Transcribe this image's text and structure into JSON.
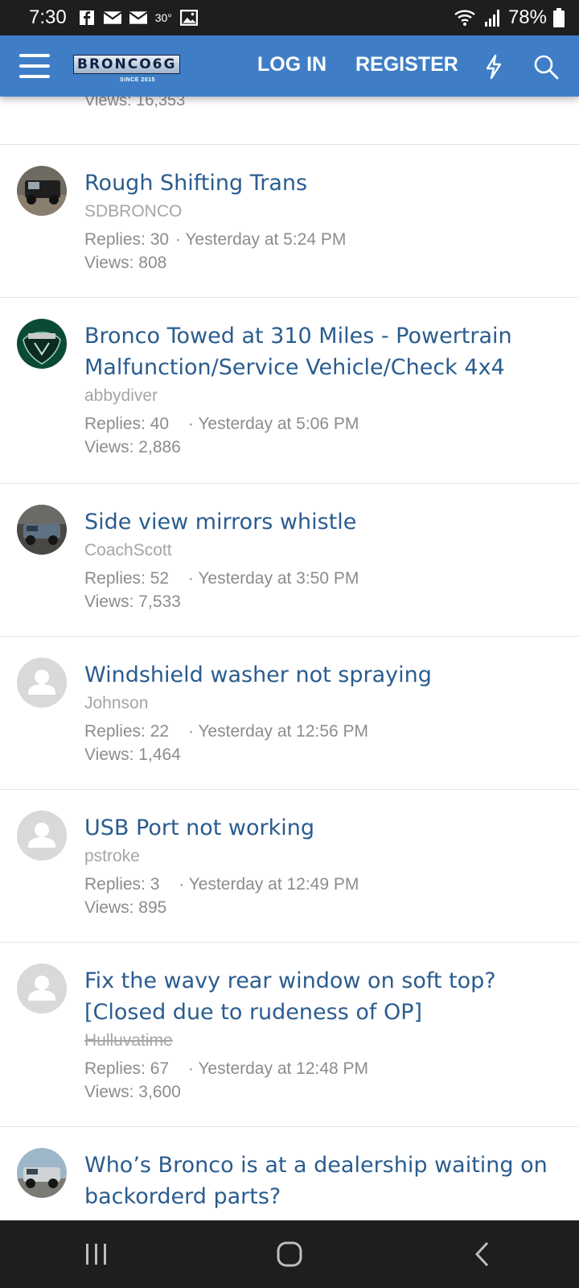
{
  "status_bar": {
    "time": "7:30",
    "temperature": "30°",
    "battery": "78%",
    "icons_left": [
      "facebook-icon",
      "mail-icon",
      "mail-icon",
      "image-icon"
    ],
    "icons_right": [
      "wifi-icon",
      "signal-icon",
      "battery-icon"
    ]
  },
  "header": {
    "logo_text": "BRONCO6G",
    "logo_sub": "SINCE 2015",
    "login_label": "LOG IN",
    "register_label": "REGISTER",
    "accent_color": "#3f7ec6"
  },
  "partial_thread": {
    "views": "Views: 16,353"
  },
  "threads": [
    {
      "title": "Rough Shifting Trans",
      "author": "SDBRONCO",
      "replies": "Replies: 30",
      "date": "· Yesterday at 5:24 PM",
      "views": "Views: 808"
    },
    {
      "title": "Bronco Towed at 310 Miles - Powertrain Malfunction/Service Vehicle/Check 4x4",
      "author": "abbydiver",
      "replies": "Replies: 40",
      "date": "· Yesterday at 5:06 PM",
      "views": "Views: 2,886"
    },
    {
      "title": "Side view mirrors whistle",
      "author": "CoachScott",
      "replies": "Replies: 52",
      "date": "· Yesterday at 3:50 PM",
      "views": "Views: 7,533"
    },
    {
      "title": "Windshield washer not spraying",
      "author": "Johnson",
      "replies": "Replies: 22",
      "date": "· Yesterday at 12:56 PM",
      "views": "Views: 1,464"
    },
    {
      "title": "USB Port not working",
      "author": "pstroke",
      "replies": "Replies: 3",
      "date": "· Yesterday at 12:49 PM",
      "views": "Views: 895"
    },
    {
      "title": "Fix the wavy rear window on soft top? [Closed due to rudeness of OP]",
      "author": "Hulluvatime",
      "replies": "Replies: 67",
      "date": "· Yesterday at 12:48 PM",
      "views": "Views: 3,600"
    },
    {
      "title": "Who’s Bronco is at a dealership waiting on backorderd parts?",
      "author": "",
      "replies": "",
      "date": "",
      "views": ""
    }
  ]
}
